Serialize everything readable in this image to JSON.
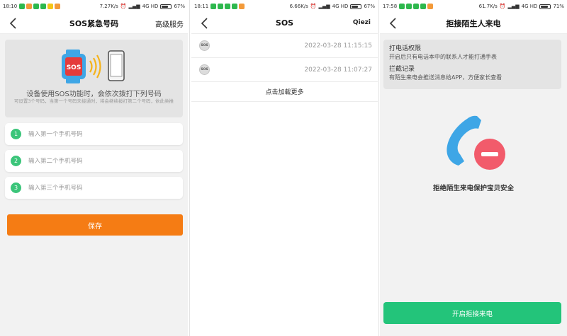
{
  "screens": [
    {
      "status": {
        "time": "18:10",
        "speed": "7.27K/s",
        "network": "4G HD",
        "battery": "67%",
        "battery_level": 0.67
      },
      "nav": {
        "title": "SOS紧急号码",
        "action": "高级服务"
      },
      "banner": {
        "title": "设备使用SOS功能时，会依次拨打下列号码",
        "subtitle": "可设置3个号码，当第一个号码未接通时，将会继续拨打第二个号码，依此类推",
        "badge": "SOS"
      },
      "inputs": [
        {
          "number": "1",
          "placeholder": "输入第一个手机号码",
          "value": ""
        },
        {
          "number": "2",
          "placeholder": "输入第二个手机号码",
          "value": ""
        },
        {
          "number": "3",
          "placeholder": "输入第三个手机号码",
          "value": ""
        }
      ],
      "save_label": "保存"
    },
    {
      "status": {
        "time": "18:11",
        "speed": "6.66K/s",
        "network": "4G HD",
        "battery": "67%",
        "battery_level": 0.67
      },
      "nav": {
        "title": "SOS",
        "action": "Qiezi"
      },
      "records": [
        {
          "icon_label": "SOS",
          "time": "2022-03-28 11:15:15"
        },
        {
          "icon_label": "SOS",
          "time": "2022-03-28 11:07:27"
        }
      ],
      "load_more": "点击加载更多"
    },
    {
      "status": {
        "time": "17:58",
        "speed": "61.7K/s",
        "network": "4G HD",
        "battery": "71%",
        "battery_level": 0.71
      },
      "nav": {
        "title": "拒接陌生人来电"
      },
      "info": [
        {
          "title": "打电话权限",
          "desc": "开启后只有电话本中的联系人才能打通手表"
        },
        {
          "title": "拦截记录",
          "desc": "有陌生来电会推送消息给APP，方便家长查看"
        }
      ],
      "caption": "拒绝陌生来电保护宝贝安全",
      "button_label": "开启拒接来电"
    }
  ],
  "colors": {
    "primary_orange": "#f57c14",
    "primary_green": "#23c47a",
    "step_green": "#3bc57a",
    "phone_blue": "#3ea6e6",
    "reject_red": "#f25b6b"
  }
}
